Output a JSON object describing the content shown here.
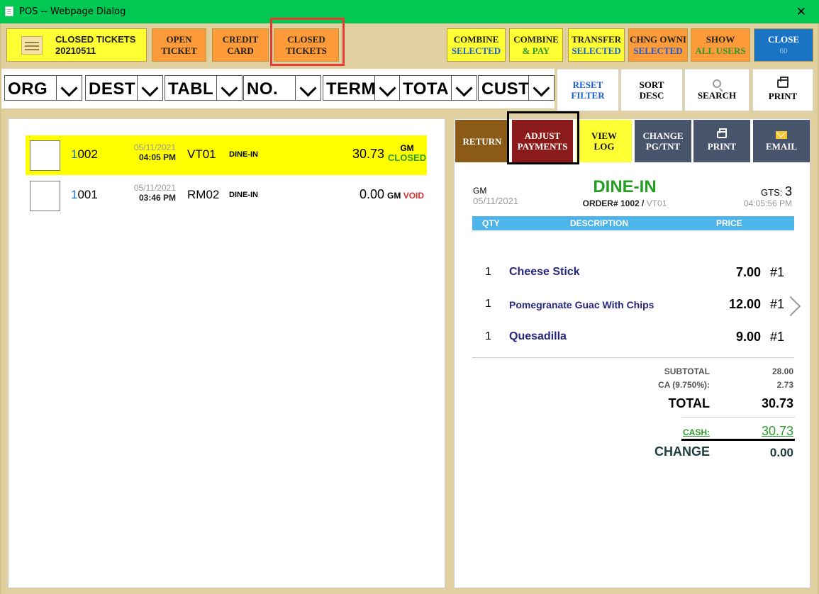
{
  "window": {
    "title": "POS -- Webpage Dialog",
    "close_glyph": "✕"
  },
  "toolbar": {
    "closed_tickets_label": "CLOSED TICKETS",
    "closed_tickets_date": "20210511",
    "open_ticket": [
      "OPEN",
      "TICKET"
    ],
    "credit_card": [
      "CREDIT",
      "CARD"
    ],
    "closed_tickets_btn": [
      "CLOSED",
      "TICKETS"
    ],
    "combine_selected": [
      "COMBINE",
      "SELECTED"
    ],
    "combine_pay": [
      "COMBINE",
      "& PAY"
    ],
    "transfer_selected": [
      "TRANSFER",
      "SELECTED"
    ],
    "chng_owner": [
      "CHNG OWNI",
      "SELECTED"
    ],
    "show_all_users": [
      "SHOW",
      "ALL USERS"
    ],
    "close": [
      "CLOSE",
      "60"
    ]
  },
  "filters": {
    "org": "ORG",
    "dest": "DEST",
    "tabl": "TABL",
    "no": "NO.",
    "term": "TERM",
    "tota": "TOTA",
    "cust": "CUST"
  },
  "filter_buttons": {
    "reset_filter": [
      "RESET",
      "FILTER"
    ],
    "sort_desc": [
      "SORT",
      "DESC"
    ],
    "search": "SEARCH",
    "print": "PRINT"
  },
  "tickets": [
    {
      "num_first": "1",
      "num_rest": "002",
      "date": "05/11/2021",
      "time": "04:05 PM",
      "table": "VT01",
      "type": "DINE-IN",
      "amount": "30.73",
      "gm": "GM",
      "status": "CLOSED"
    },
    {
      "num_first": "1",
      "num_rest": "001",
      "date": "05/11/2021",
      "time": "03:46 PM",
      "table": "RM02",
      "type": "DINE-IN",
      "amount": "0.00",
      "gm": "GM",
      "status": "VOID"
    }
  ],
  "detail_tabs": {
    "return": "RETURN",
    "adjust_payments": [
      "ADJUST",
      "PAYMENTS"
    ],
    "view_log": [
      "VIEW",
      "LOG"
    ],
    "change_pg": [
      "CHANGE",
      "PG/TNT"
    ],
    "print": "PRINT",
    "email": "EMAIL"
  },
  "receipt": {
    "gm": "GM",
    "date": "05/11/2021",
    "type": "DINE-IN",
    "order_label": "ORDER# 1002 /",
    "order_table": "VT01",
    "gts_label": "GTS:",
    "gts_value": "3",
    "time": "04:05:56 PM",
    "header": {
      "qty": "QTY",
      "description": "DESCRIPTION",
      "price": "PRICE"
    },
    "items": [
      {
        "qty": "1",
        "desc": "Cheese Stick",
        "price": "7.00",
        "seat": "#1"
      },
      {
        "qty": "1",
        "desc": "Pomegranate Guac With Chips",
        "price": "12.00",
        "seat": "#1"
      },
      {
        "qty": "1",
        "desc": "Quesadilla",
        "price": "9.00",
        "seat": "#1"
      }
    ],
    "subtotal_label": "SUBTOTAL",
    "subtotal_value": "28.00",
    "tax_label": "CA (9.750%):",
    "tax_value": "2.73",
    "total_label": "TOTAL",
    "total_value": "30.73",
    "cash_label": "CASH:",
    "cash_value": "30.73",
    "change_label": "CHANGE",
    "change_value": "0.00"
  },
  "colors": {
    "title_bar": "#00c853",
    "toolbar_yellow": "#ffff33",
    "toolbar_orange": "#fd9a3a",
    "close_blue": "#1a74c4",
    "dine_in_green": "#22a022",
    "void_red": "#d32f2f",
    "highlight_red": "#e53935"
  }
}
